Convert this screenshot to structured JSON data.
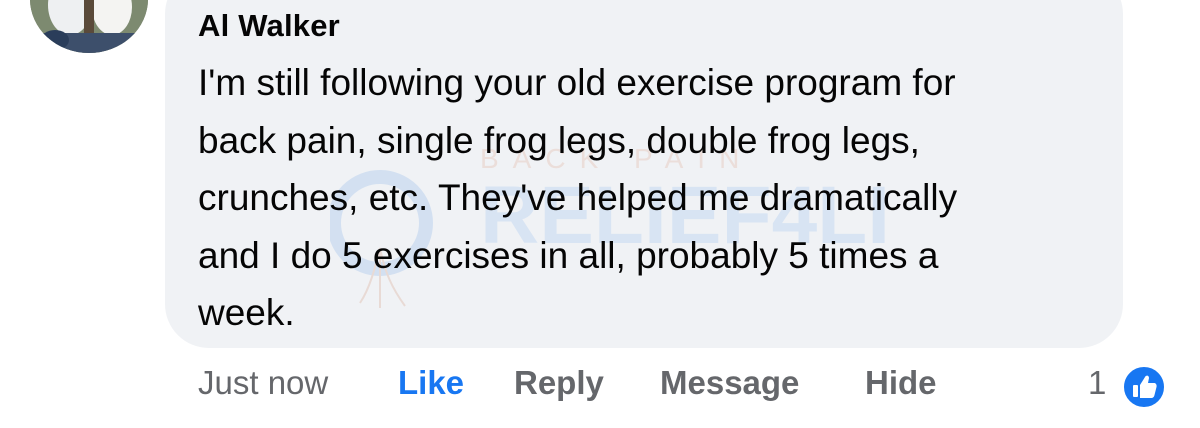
{
  "comment": {
    "author": "Al Walker",
    "text_lines": [
      "I'm still following your old exercise program for",
      "back pain, single frog legs, double frog legs,",
      "crunches, etc. They've helped me dramatically",
      "and I do 5 exercises in all, probably 5 times a",
      "week."
    ]
  },
  "actions": {
    "timestamp": "Just now",
    "like": "Like",
    "reply": "Reply",
    "message": "Message",
    "hide": "Hide"
  },
  "reactions": {
    "count": "1",
    "icon": "thumbs-up-icon"
  },
  "watermark": {
    "top_text": "BACK PAIN",
    "main_text": "RELIEF4LIFE"
  },
  "colors": {
    "bubble": "#f0f2f5",
    "text": "#050505",
    "muted": "#65676b",
    "accent": "#1877f2"
  }
}
